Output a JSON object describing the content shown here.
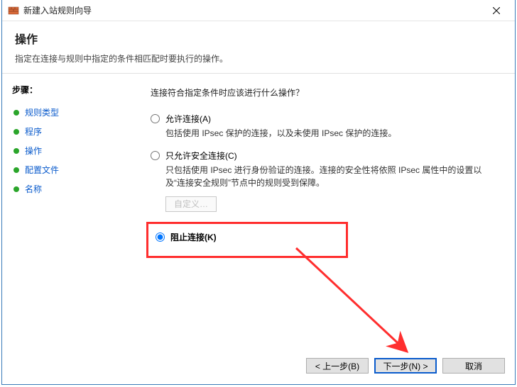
{
  "window": {
    "title": "新建入站规则向导"
  },
  "header": {
    "title": "操作",
    "subtitle": "指定在连接与规则中指定的条件相匹配时要执行的操作。"
  },
  "sidebar": {
    "label": "步骤：",
    "items": [
      {
        "label": "规则类型"
      },
      {
        "label": "程序"
      },
      {
        "label": "操作"
      },
      {
        "label": "配置文件"
      },
      {
        "label": "名称"
      }
    ]
  },
  "content": {
    "question": "连接符合指定条件时应该进行什么操作？",
    "options": [
      {
        "id": "allow",
        "title": "允许连接(A)",
        "desc": "包括使用 IPsec 保护的连接，以及未使用 IPsec 保护的连接。"
      },
      {
        "id": "allow_secure",
        "title": "只允许安全连接(C)",
        "desc": "只包括使用 IPsec 进行身份验证的连接。连接的安全性将依照 IPsec 属性中的设置以及“连接安全规则”节点中的规则受到保障。"
      },
      {
        "id": "block",
        "title": "阻止连接(K)",
        "desc": ""
      }
    ],
    "customize_label": "自定义…",
    "selected": "block"
  },
  "buttons": {
    "back": "< 上一步(B)",
    "next": "下一步(N) >",
    "cancel": "取消"
  }
}
